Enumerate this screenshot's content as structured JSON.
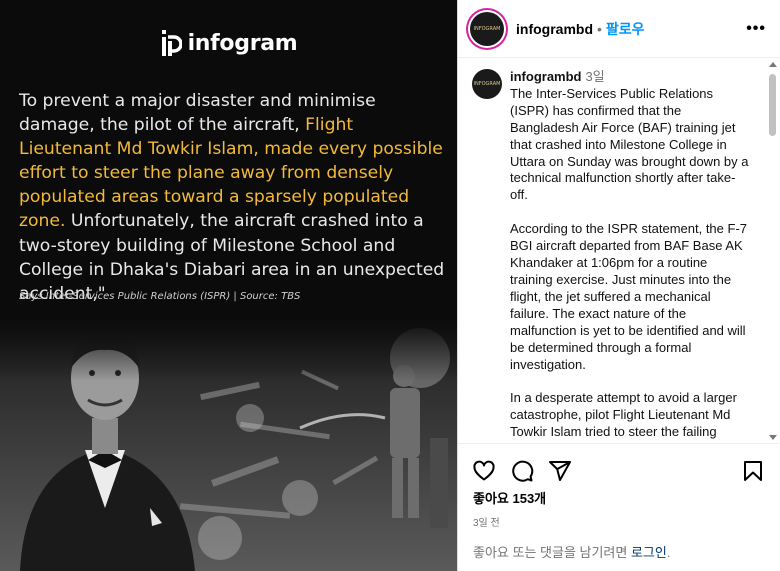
{
  "image": {
    "brand_name": "infogram",
    "quote_before": "To prevent a major disaster and minimise damage, the pilot of the aircraft, ",
    "quote_highlight": "Flight Lieutenant Md Towkir Islam, made every possible effort to steer the plane away from densely populated areas toward a sparsely populated zone.",
    "quote_after": " Unfortunately, the aircraft crashed into a two-storey building of Milestone School and College in Dhaka's Diabari area in an unexpected accident,\"",
    "source": "Says Inter-Services Public Relations (ISPR) | Source: TBS",
    "highlight_color": "#f2b93b"
  },
  "header": {
    "username": "infogrambd",
    "separator": "•",
    "follow_label": "팔로우",
    "more_label": "•••",
    "avatar_text": "INFOGRAM"
  },
  "caption": {
    "username": "infogrambd",
    "time": "3일",
    "paragraphs": [
      "The Inter-Services Public Relations (ISPR) has confirmed that the Bangladesh Air Force (BAF) training jet that crashed into Milestone College in Uttara on Sunday was brought down by a technical malfunction shortly after take-off.",
      "According to the ISPR statement, the F-7 BGI aircraft departed from BAF Base AK Khandaker at 1:06pm for a routine training exercise. Just minutes into the flight, the jet suffered a mechanical failure. The exact nature of the malfunction is yet to be identified and will be determined through a formal investigation.",
      "In a desperate attempt to avoid a larger catastrophe, pilot Flight Lieutenant Md Towkir Islam tried to steer the failing"
    ]
  },
  "actions": {
    "likes_label": "좋아요 153개",
    "date_label": "3일 전",
    "login_prefix": "좋아요 또는 댓글을 남기려면 ",
    "login_link": "로그인",
    "login_suffix": "."
  },
  "colors": {
    "accent": "#0095f6",
    "link": "#00376b",
    "muted": "#737373"
  }
}
